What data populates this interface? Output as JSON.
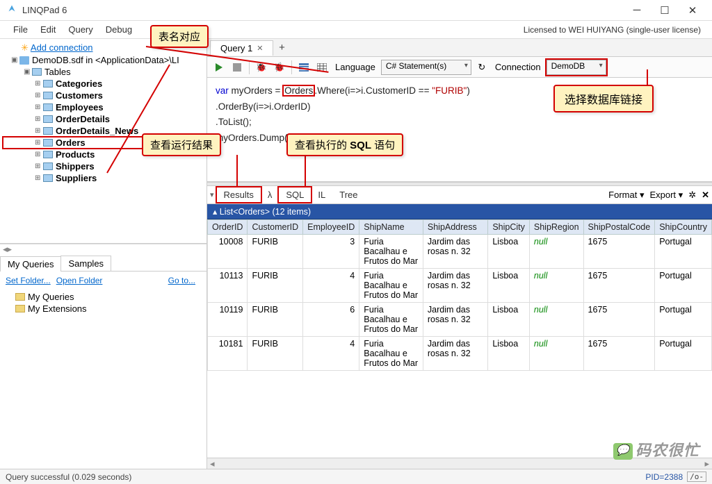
{
  "window": {
    "title": "LINQPad 6"
  },
  "menu": {
    "items": [
      "File",
      "Edit",
      "Query",
      "Debug"
    ],
    "license": "Licensed to WEI HUIYANG (single-user license)"
  },
  "tree": {
    "add_conn": "Add connection",
    "conn": "DemoDB.sdf in <ApplicationData>\\LI",
    "tables_label": "Tables",
    "tables": [
      "Categories",
      "Customers",
      "Employees",
      "OrderDetails",
      "OrderDetails_News",
      "Orders",
      "Products",
      "Shippers",
      "Suppliers"
    ]
  },
  "query_tabs": {
    "my_queries": "My Queries",
    "samples": "Samples",
    "set_folder": "Set Folder...",
    "open_folder": "Open Folder",
    "goto": "Go to...",
    "folders": [
      "My Queries",
      "My Extensions"
    ]
  },
  "doc_tabs": {
    "active": "Query 1"
  },
  "toolbar": {
    "lang_label": "Language",
    "lang_value": "C# Statement(s)",
    "conn_label": "Connection",
    "conn_value": "DemoDB"
  },
  "editor": {
    "l1a": "var",
    "l1b": " myOrders = ",
    "l1_orders": "Orders",
    "l1c": ".Where(i=>i.CustomerID == ",
    "l1_str": "\"FURIB\"",
    "l1d": ")",
    "l2": ".OrderBy(i=>i.OrderID)",
    "l3": ".ToList();",
    "l4": "myOrders.Dump();"
  },
  "result_tabs": {
    "results": "Results",
    "lambda": "λ",
    "sql": "SQL",
    "il": "IL",
    "tree": "Tree",
    "format": "Format",
    "export": "Export"
  },
  "grid": {
    "title": "List<Orders> (12 items)",
    "cols": [
      "OrderID",
      "CustomerID",
      "EmployeeID",
      "ShipName",
      "ShipAddress",
      "ShipCity",
      "ShipRegion",
      "ShipPostalCode",
      "ShipCountry"
    ],
    "rows": [
      {
        "OrderID": "10008",
        "CustomerID": "FURIB",
        "EmployeeID": "3",
        "ShipName": "Furia Bacalhau e Frutos do Mar",
        "ShipAddress": "Jardim das rosas n. 32",
        "ShipCity": "Lisboa",
        "ShipRegion": null,
        "ShipPostalCode": "1675",
        "ShipCountry": "Portugal"
      },
      {
        "OrderID": "10113",
        "CustomerID": "FURIB",
        "EmployeeID": "4",
        "ShipName": "Furia Bacalhau e Frutos do Mar",
        "ShipAddress": "Jardim das rosas n. 32",
        "ShipCity": "Lisboa",
        "ShipRegion": null,
        "ShipPostalCode": "1675",
        "ShipCountry": "Portugal"
      },
      {
        "OrderID": "10119",
        "CustomerID": "FURIB",
        "EmployeeID": "6",
        "ShipName": "Furia Bacalhau e Frutos do Mar",
        "ShipAddress": "Jardim das rosas n. 32",
        "ShipCity": "Lisboa",
        "ShipRegion": null,
        "ShipPostalCode": "1675",
        "ShipCountry": "Portugal"
      },
      {
        "OrderID": "10181",
        "CustomerID": "FURIB",
        "EmployeeID": "4",
        "ShipName": "Furia Bacalhau e Frutos do Mar",
        "ShipAddress": "Jardim das rosas n. 32",
        "ShipCity": "Lisboa",
        "ShipRegion": null,
        "ShipPostalCode": "1675",
        "ShipCountry": "Portugal"
      }
    ]
  },
  "status": {
    "msg": "Query successful  (0.029 seconds)",
    "pid": "PID=2388",
    "oo": "/o-"
  },
  "callouts": {
    "table_map": "表名对应",
    "view_results": "查看运行结果",
    "view_sql": "查看执行的 SQL 语句",
    "choose_db": "选择数据库链接"
  },
  "watermark": "码农很忙"
}
